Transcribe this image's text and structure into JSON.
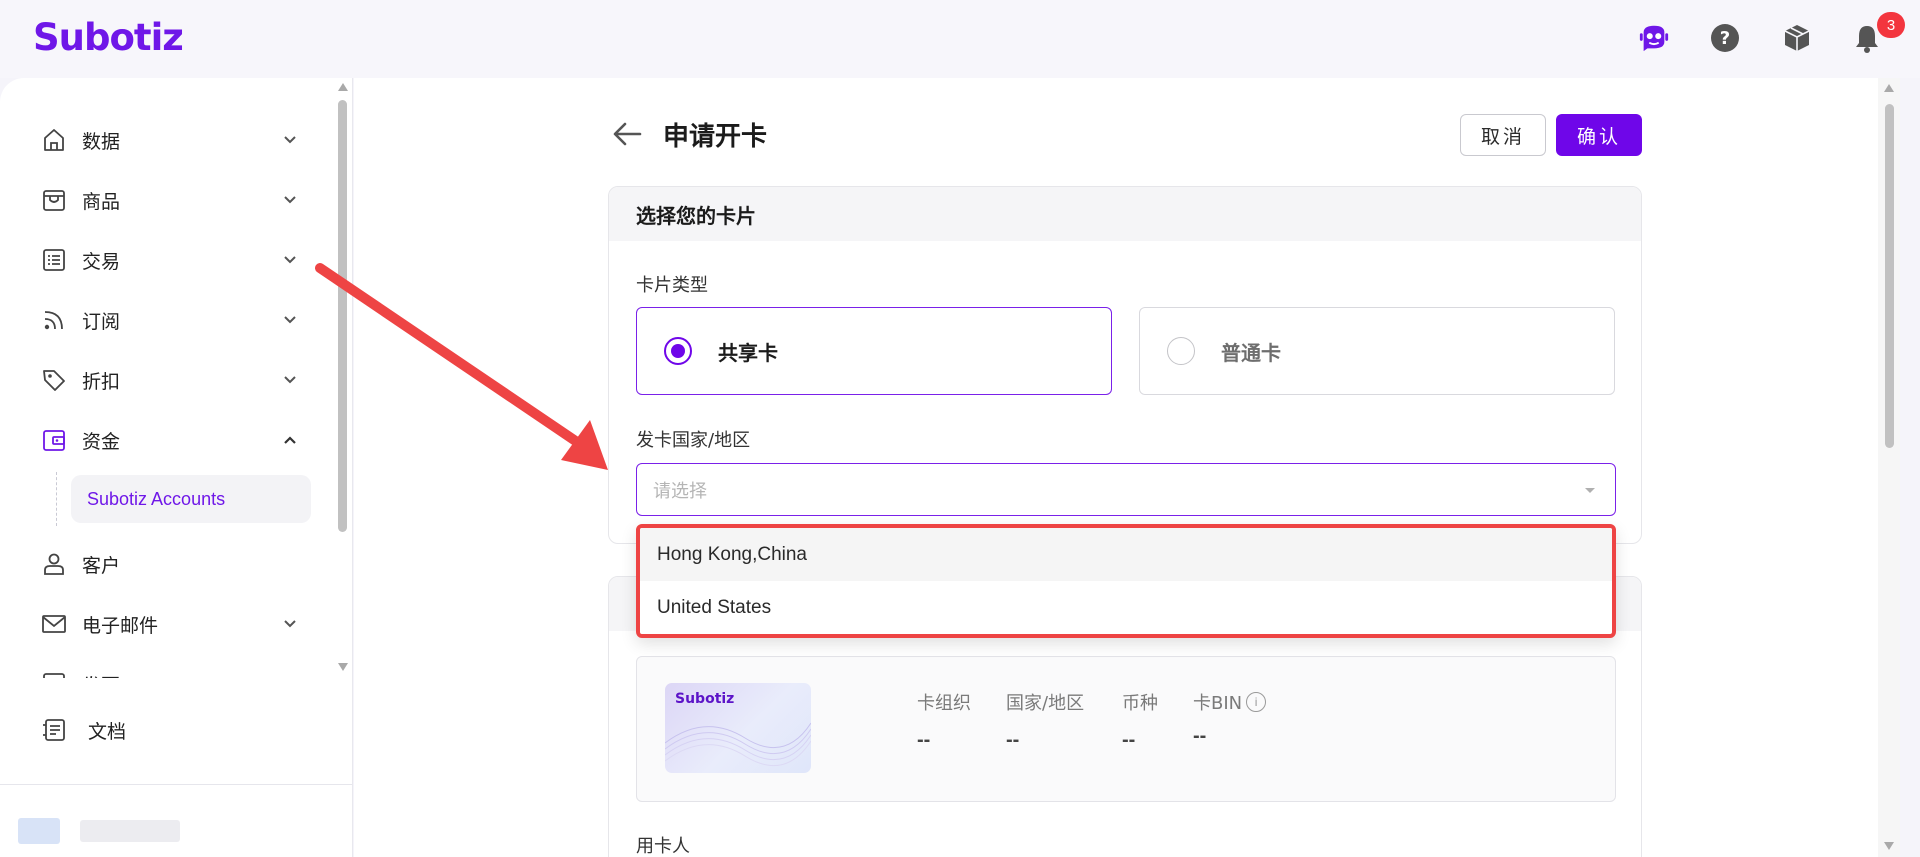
{
  "app": {
    "logo": "Subotiz",
    "notification_count": "3"
  },
  "topbar": {
    "icons": [
      "assistant-bot-icon",
      "help-icon",
      "package-icon",
      "bell-icon"
    ]
  },
  "sidebar": {
    "items": [
      {
        "label": "数据",
        "icon": "home-icon",
        "expandable": true
      },
      {
        "label": "商品",
        "icon": "store-icon",
        "expandable": true
      },
      {
        "label": "交易",
        "icon": "list-icon",
        "expandable": true
      },
      {
        "label": "订阅",
        "icon": "rss-icon",
        "expandable": true
      },
      {
        "label": "折扣",
        "icon": "tag-icon",
        "expandable": true
      },
      {
        "label": "资金",
        "icon": "wallet-icon",
        "expandable": true,
        "expanded": true,
        "active": true
      },
      {
        "label": "客户",
        "icon": "user-icon",
        "expandable": false
      },
      {
        "label": "电子邮件",
        "icon": "mail-icon",
        "expandable": true
      },
      {
        "label": "发票",
        "icon": "invoice-icon",
        "expandable": true
      }
    ],
    "sub_item": "Subotiz Accounts",
    "docs_label": "文档"
  },
  "page": {
    "title": "申请开卡",
    "cancel_label": "取消",
    "confirm_label": "确认",
    "section_title": "选择您的卡片",
    "card_type_label": "卡片类型",
    "card_types": [
      {
        "label": "共享卡",
        "selected": true
      },
      {
        "label": "普通卡",
        "selected": false
      }
    ],
    "country_label": "发卡国家/地区",
    "country_placeholder": "请选择",
    "country_options": [
      "Hong Kong,China",
      "United States"
    ],
    "card_thumb_logo": "Subotiz",
    "info_headers": [
      "卡组织",
      "国家/地区",
      "币种",
      "卡BIN"
    ],
    "info_values": [
      "--",
      "--",
      "--",
      "--"
    ],
    "card_user_label": "用卡人"
  },
  "colors": {
    "brand": "#6f06e9",
    "annotation": "#ee4444",
    "badge": "#f3353e"
  }
}
